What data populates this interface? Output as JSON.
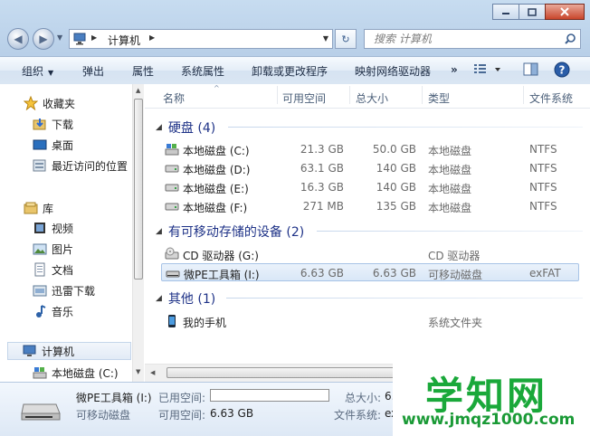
{
  "address": {
    "crumbs": [
      "计算机"
    ]
  },
  "search": {
    "placeholder": "搜索 计算机"
  },
  "toolbar": {
    "organize": "组织",
    "eject": "弹出",
    "properties": "属性",
    "system_properties": "系统属性",
    "uninstall": "卸载或更改程序",
    "map_drive": "映射网络驱动器",
    "more": "»"
  },
  "sidebar": {
    "favorites_header": "收藏夹",
    "favorites": [
      "下载",
      "桌面",
      "最近访问的位置"
    ],
    "libraries_header": "库",
    "libraries": [
      "视频",
      "图片",
      "文档",
      "迅雷下载",
      "音乐"
    ],
    "computer_header": "计算机",
    "computer_items": [
      "本地磁盘 (C:)"
    ]
  },
  "columns": {
    "name": "名称",
    "free": "可用空间",
    "total": "总大小",
    "type": "类型",
    "fs": "文件系统"
  },
  "groups": {
    "disks": {
      "title": "硬盘 (4)"
    },
    "removable": {
      "title": "有可移动存储的设备 (2)"
    },
    "other": {
      "title": "其他 (1)"
    }
  },
  "disks": [
    {
      "name": "本地磁盘 (C:)",
      "free": "21.3 GB",
      "total": "50.0 GB",
      "type": "本地磁盘",
      "fs": "NTFS"
    },
    {
      "name": "本地磁盘 (D:)",
      "free": "63.1 GB",
      "total": "140 GB",
      "type": "本地磁盘",
      "fs": "NTFS"
    },
    {
      "name": "本地磁盘 (E:)",
      "free": "16.3 GB",
      "total": "140 GB",
      "type": "本地磁盘",
      "fs": "NTFS"
    },
    {
      "name": "本地磁盘 (F:)",
      "free": "271 MB",
      "total": "135 GB",
      "type": "本地磁盘",
      "fs": "NTFS"
    }
  ],
  "removable": [
    {
      "name": "CD 驱动器 (G:)",
      "free": "",
      "total": "",
      "type": "CD 驱动器",
      "fs": ""
    },
    {
      "name": "微PE工具箱 (I:)",
      "free": "6.63 GB",
      "total": "6.63 GB",
      "type": "可移动磁盘",
      "fs": "exFAT"
    }
  ],
  "other": [
    {
      "name": "我的手机",
      "type": "系统文件夹"
    }
  ],
  "details": {
    "name": "微PE工具箱 (I:)",
    "type": "可移动磁盘",
    "used_label": "已用空间:",
    "free_label": "可用空间:",
    "free_value": "6.63 GB",
    "total_label": "总大小:",
    "total_value": "6.",
    "fs_label": "文件系统:",
    "fs_value": "ex",
    "used_fraction": 0.0
  },
  "watermark": {
    "title": "学知网",
    "url": "www.jmqz1000.com"
  }
}
